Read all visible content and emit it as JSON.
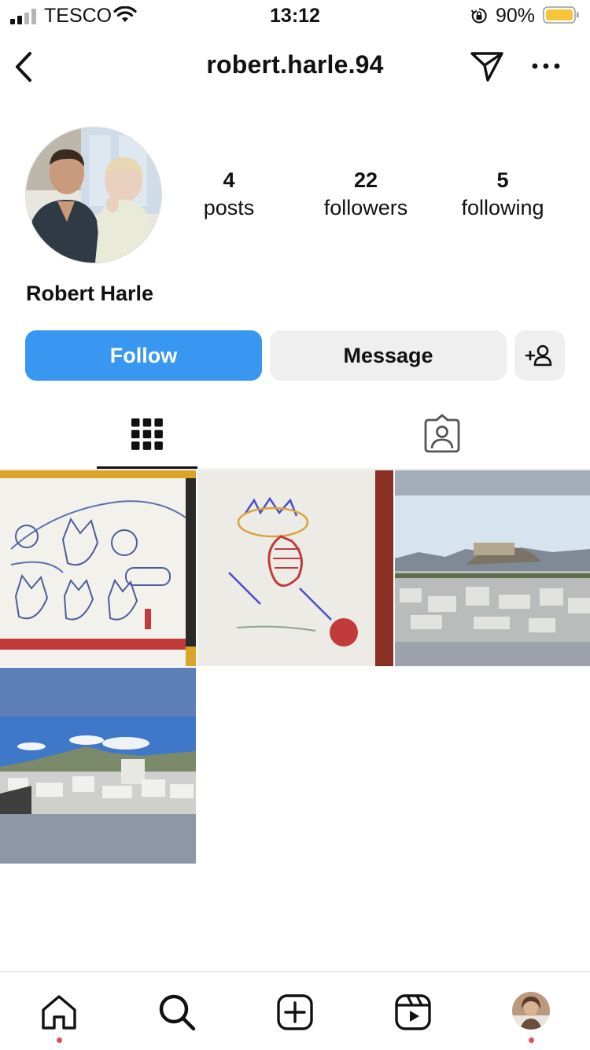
{
  "status_bar": {
    "carrier": "TESCO",
    "time": "13:12",
    "battery": "90%"
  },
  "header": {
    "username": "robert.harle.94"
  },
  "profile": {
    "display_name": "Robert Harle",
    "stats": [
      {
        "value": "4",
        "label": "posts"
      },
      {
        "value": "22",
        "label": "followers"
      },
      {
        "value": "5",
        "label": "following"
      }
    ]
  },
  "actions": {
    "follow": "Follow",
    "message": "Message"
  },
  "tabs": {
    "active": "grid"
  },
  "colors": {
    "follow_blue": "#3897f0",
    "button_gray": "#efefef",
    "notification_red": "#ed4956"
  },
  "icons": {
    "back": "chevron-left-icon",
    "send": "paper-plane-icon",
    "more": "ellipsis-icon",
    "add_user": "add-user-icon",
    "grid": "grid-icon",
    "tagged": "tagged-icon",
    "home": "home-icon",
    "search": "search-icon",
    "create": "plus-square-icon",
    "reels": "reels-icon"
  }
}
